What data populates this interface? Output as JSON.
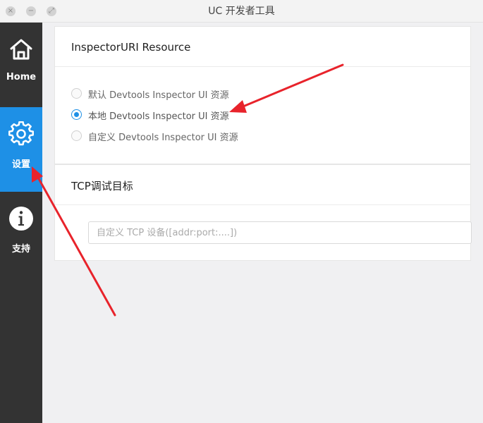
{
  "window": {
    "title": "UC 开发者工具",
    "close_glyph": "×",
    "min_glyph": "−",
    "max_glyph": "⤢"
  },
  "sidebar": {
    "items": [
      {
        "label": "Home",
        "icon": "home-icon",
        "active": false
      },
      {
        "label": "设置",
        "icon": "gear-icon",
        "active": true
      },
      {
        "label": "支持",
        "icon": "info-icon",
        "active": false
      }
    ]
  },
  "inspector": {
    "title": "InspectorURI Resource",
    "options": [
      {
        "label": "默认 Devtools Inspector UI 资源",
        "checked": false
      },
      {
        "label": "本地 Devtools Inspector UI 资源",
        "checked": true
      },
      {
        "label": "自定义 Devtools Inspector UI 资源",
        "checked": false
      }
    ]
  },
  "tcp": {
    "title": "TCP调试目标",
    "placeholder": "自定义 TCP 设备([addr:port:....])",
    "value": ""
  },
  "colors": {
    "sidebar_bg": "#333333",
    "accent": "#1e90e6",
    "annotation_arrow": "#e8232b"
  }
}
